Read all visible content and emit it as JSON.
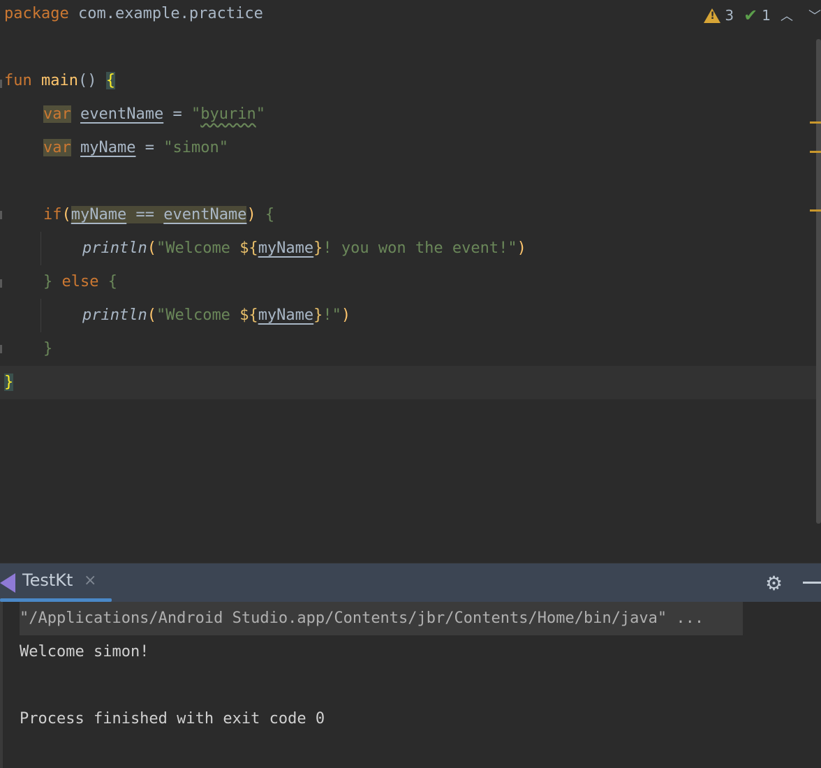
{
  "editor": {
    "package_kw": "package",
    "package_name": " com.example.practice",
    "line_fun": {
      "kw": "fun",
      "name": " main",
      "parens": "()",
      "brace": "{"
    },
    "line_var1": {
      "kw": "var",
      "name": "eventName",
      "eq": " = ",
      "str_open": "\"",
      "str_val": "byurin",
      "str_close": "\""
    },
    "line_var2": {
      "kw": "var",
      "name": "myName",
      "eq": " = ",
      "str": "\"simon\""
    },
    "line_if": {
      "kw": "if",
      "open": "(",
      "left": "myName",
      "op": " == ",
      "right": "eventName",
      "close": ")",
      "brace": " {"
    },
    "line_print1": {
      "call": "println",
      "open": "(",
      "s1": "\"Welcome ",
      "t_open": "${",
      "t_var": "myName",
      "t_close": "}",
      "s2": "! you won the event!\"",
      "close": ")"
    },
    "line_else": {
      "brace1": "}",
      "kw": " else",
      "brace2": " {"
    },
    "line_print2": {
      "call": "println",
      "open": "(",
      "s1": "\"Welcome ",
      "t_open": "${",
      "t_var": "myName",
      "t_close": "}",
      "s2": "!\"",
      "close": ")"
    },
    "line_close_if": "}",
    "line_close_main": "}"
  },
  "inspections": {
    "warnings": "3",
    "typos": "1",
    "icons": [
      "warning-icon",
      "typo-check-icon",
      "chevron-up-icon",
      "chevron-down-icon"
    ]
  },
  "run_panel": {
    "tab_label": "TestKt",
    "close_glyph": "×",
    "icons": [
      "kotlin-icon",
      "close-icon",
      "gear-icon",
      "minimize-icon"
    ]
  },
  "console": {
    "command": "\"/Applications/Android Studio.app/Contents/jbr/Contents/Home/bin/java\" ...",
    "output": "Welcome simon!",
    "exit": "Process finished with exit code 0"
  },
  "colors": {
    "keyword": "#cc7832",
    "function": "#ffc66d",
    "string": "#6a8759",
    "text": "#a9b7c6",
    "panel_header": "#3c4553",
    "tab_underline": "#4a88c7",
    "warning": "#d7a536"
  }
}
